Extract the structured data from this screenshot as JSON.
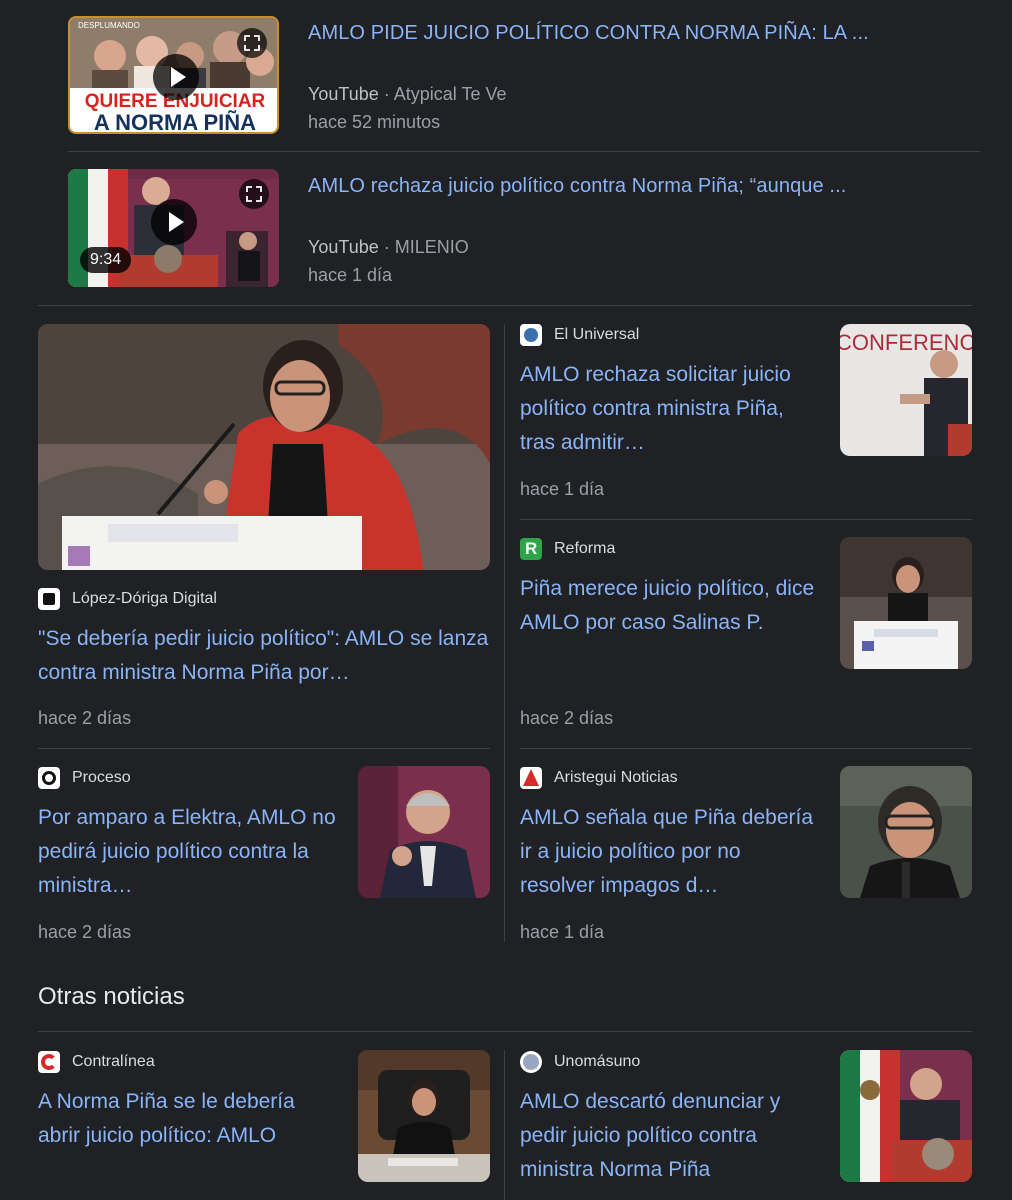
{
  "videos": [
    {
      "title": "AMLO PIDE JUICIO POLÍTICO CONTRA NORMA PIÑA: LA ...",
      "platform": "YouTube",
      "channel": "Atypical Te Ve",
      "time": "hace 52 minutos",
      "thumb_text": {
        "top": "DESPLUMANDO",
        "line1": "QUIERE ENJUICIAR",
        "line2": "A NORMA PIÑA"
      }
    },
    {
      "title": "AMLO rechaza juicio político contra Norma Piña; “aunque ...",
      "platform": "YouTube",
      "channel": "MILENIO",
      "time": "hace 1 día",
      "duration": "9:34"
    }
  ],
  "separator": "·",
  "top_stories": {
    "featured": {
      "source": "López-Dóriga Digital",
      "title": "\"Se debería pedir juicio político\": AMLO se lanza contra ministra Norma Piña por…",
      "time": "hace 2 días"
    },
    "cards": [
      {
        "source": "El Universal",
        "title": "AMLO rechaza solicitar juicio político contra ministra Piña, tras admitir…",
        "time": "hace 1 día",
        "img_text": "CONFERENCIA DE PRENSA"
      },
      {
        "source": "Reforma",
        "title": "Piña merece juicio político, dice AMLO por caso Salinas P.",
        "time": "hace 2 días"
      },
      {
        "source": "Proceso",
        "title": "Por amparo a Elektra, AMLO no pedirá juicio político contra la ministra…",
        "time": "hace 2 días"
      },
      {
        "source": "Aristegui Noticias",
        "title": "AMLO señala que Piña debería ir a juicio político por no resolver impagos d…",
        "time": "hace 1 día"
      }
    ]
  },
  "other_news": {
    "heading": "Otras noticias",
    "cards": [
      {
        "source": "Contralínea",
        "title": "A Norma Piña se le debería abrir juicio político: AMLO"
      },
      {
        "source": "Unomásuno",
        "title": "AMLO descartó denunciar y pedir juicio político contra ministra Norma Piña"
      }
    ]
  },
  "colors": {
    "background": "#202124",
    "link": "#8ab4f8",
    "secondary_text": "#9aa0a6",
    "divider": "#3c4043"
  }
}
